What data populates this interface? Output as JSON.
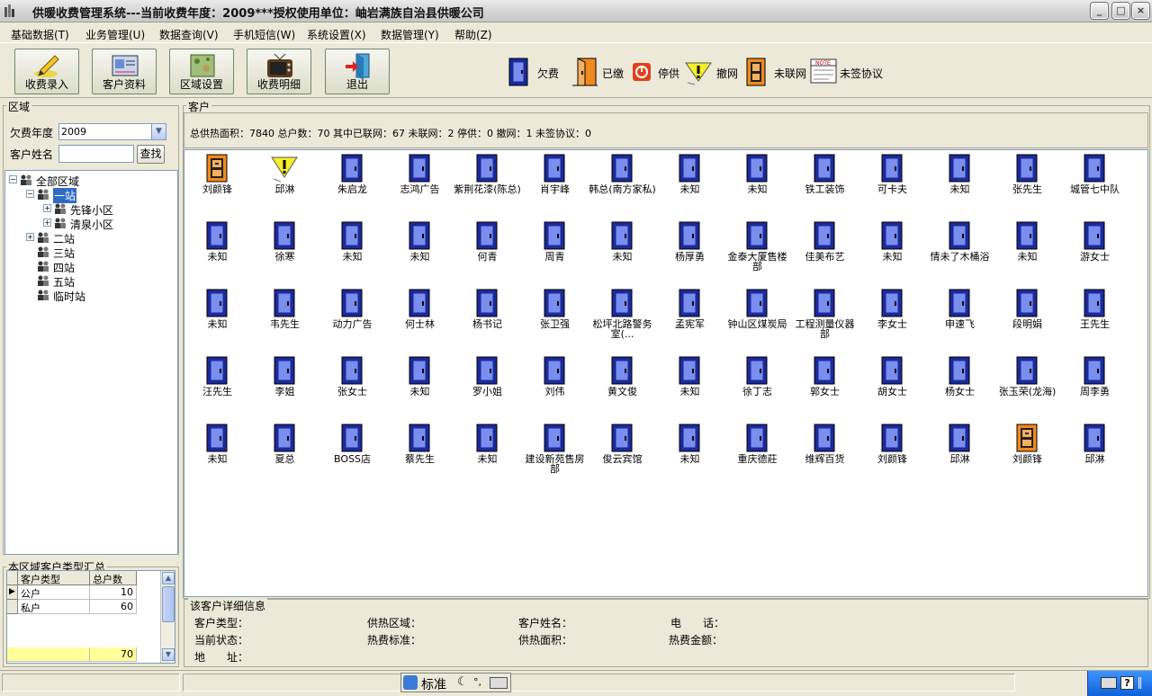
{
  "window": {
    "title": "供暖收费管理系统---当前收费年度：2009***授权使用单位：岫岩满族自治县供暖公司",
    "min_glyph": "_",
    "max_glyph": "□",
    "close_glyph": "×"
  },
  "menu": [
    {
      "label": "基础数据(T)"
    },
    {
      "label": "业务管理(U)"
    },
    {
      "label": "数据查询(V)"
    },
    {
      "label": "手机短信(W)"
    },
    {
      "label": "系统设置(X)"
    },
    {
      "label": "数据管理(Y)"
    },
    {
      "label": "帮助(Z)"
    }
  ],
  "toolbar": [
    {
      "label": "收费录入",
      "icon": "pencil-icon"
    },
    {
      "label": "客户资料",
      "icon": "card-icon"
    },
    {
      "label": "区域设置",
      "icon": "map-icon"
    },
    {
      "label": "收费明细",
      "icon": "tv-icon"
    },
    {
      "label": "退出",
      "icon": "exit-door-icon"
    }
  ],
  "legend": [
    {
      "label": "欠费",
      "icon": "door-blue"
    },
    {
      "label": "已缴",
      "icon": "door-orange-open"
    },
    {
      "label": "停供",
      "icon": "stop-icon"
    },
    {
      "label": "撤网",
      "icon": "warning-icon"
    },
    {
      "label": "未联网",
      "icon": "door-safe"
    },
    {
      "label": "未签协议",
      "icon": "note-icon"
    }
  ],
  "area_panel": {
    "title": "区域",
    "year_label": "欠费年度",
    "year_value": "2009",
    "name_label": "客户姓名",
    "name_value": "",
    "search_label": "查找"
  },
  "tree": [
    {
      "label": "全部区域",
      "level": 0,
      "expander": "−",
      "selected": false
    },
    {
      "label": "一站",
      "level": 1,
      "expander": "−",
      "selected": true
    },
    {
      "label": "先锋小区",
      "level": 2,
      "expander": "+",
      "selected": false
    },
    {
      "label": "清泉小区",
      "level": 2,
      "expander": "+",
      "selected": false
    },
    {
      "label": "二站",
      "level": 1,
      "expander": "+",
      "selected": false
    },
    {
      "label": "三站",
      "level": 1,
      "expander": "",
      "selected": false
    },
    {
      "label": "四站",
      "level": 1,
      "expander": "",
      "selected": false
    },
    {
      "label": "五站",
      "level": 1,
      "expander": "",
      "selected": false
    },
    {
      "label": "临时站",
      "level": 1,
      "expander": "",
      "selected": false
    }
  ],
  "summary": {
    "title": "本区域客户类型汇总",
    "headers": [
      "客户类型",
      "总户数"
    ],
    "rows": [
      {
        "type": "公户",
        "count": "10"
      },
      {
        "type": "私户",
        "count": "60"
      }
    ],
    "total": "70"
  },
  "customers_panel": {
    "title": "客户",
    "stats": "总供热面积：7840 总户数：70 其中已联网：67 未联网：2 停供：0 撤网：1 未签协议：0"
  },
  "customers": [
    {
      "name": "刘颜锋",
      "status": "safe"
    },
    {
      "name": "邱淋",
      "status": "warning"
    },
    {
      "name": "朱启龙",
      "status": "blue"
    },
    {
      "name": "志鸿广告",
      "status": "blue"
    },
    {
      "name": "紫荆花漆(陈总)",
      "status": "blue"
    },
    {
      "name": "肖宇峰",
      "status": "blue"
    },
    {
      "name": "韩总(南方家私)",
      "status": "blue"
    },
    {
      "name": "未知",
      "status": "blue"
    },
    {
      "name": "未知",
      "status": "blue"
    },
    {
      "name": "铁工装饰",
      "status": "blue"
    },
    {
      "name": "可卡夫",
      "status": "blue"
    },
    {
      "name": "未知",
      "status": "blue"
    },
    {
      "name": "张先生",
      "status": "blue"
    },
    {
      "name": "城管七中队",
      "status": "blue"
    },
    {
      "name": "未知",
      "status": "blue"
    },
    {
      "name": "徐寒",
      "status": "blue"
    },
    {
      "name": "未知",
      "status": "blue"
    },
    {
      "name": "未知",
      "status": "blue"
    },
    {
      "name": "何青",
      "status": "blue"
    },
    {
      "name": "周青",
      "status": "blue"
    },
    {
      "name": "未知",
      "status": "blue"
    },
    {
      "name": "杨厚勇",
      "status": "blue"
    },
    {
      "name": "金泰大厦售楼部",
      "status": "blue"
    },
    {
      "name": "佳美布艺",
      "status": "blue"
    },
    {
      "name": "未知",
      "status": "blue"
    },
    {
      "name": "情未了木桶浴",
      "status": "blue"
    },
    {
      "name": "未知",
      "status": "blue"
    },
    {
      "name": "游女士",
      "status": "blue"
    },
    {
      "name": "未知",
      "status": "blue"
    },
    {
      "name": "韦先生",
      "status": "blue"
    },
    {
      "name": "动力广告",
      "status": "blue"
    },
    {
      "name": "何士林",
      "status": "blue"
    },
    {
      "name": "杨书记",
      "status": "blue"
    },
    {
      "name": "张卫强",
      "status": "blue"
    },
    {
      "name": "松坪北路警务室(...",
      "status": "blue"
    },
    {
      "name": "孟宪军",
      "status": "blue"
    },
    {
      "name": "钟山区煤炭局",
      "status": "blue"
    },
    {
      "name": "工程测量仪器部",
      "status": "blue"
    },
    {
      "name": "李女士",
      "status": "blue"
    },
    {
      "name": "申速飞",
      "status": "blue"
    },
    {
      "name": "段明娟",
      "status": "blue"
    },
    {
      "name": "王先生",
      "status": "blue"
    },
    {
      "name": "汪先生",
      "status": "blue"
    },
    {
      "name": "李姐",
      "status": "blue"
    },
    {
      "name": "张女士",
      "status": "blue"
    },
    {
      "name": "未知",
      "status": "blue"
    },
    {
      "name": "罗小姐",
      "status": "blue"
    },
    {
      "name": "刘伟",
      "status": "blue"
    },
    {
      "name": "黄文俊",
      "status": "blue"
    },
    {
      "name": "未知",
      "status": "blue"
    },
    {
      "name": "徐丁志",
      "status": "blue"
    },
    {
      "name": "郭女士",
      "status": "blue"
    },
    {
      "name": "胡女士",
      "status": "blue"
    },
    {
      "name": "杨女士",
      "status": "blue"
    },
    {
      "name": "张玉荣(龙海)",
      "status": "blue"
    },
    {
      "name": "周李勇",
      "status": "blue"
    },
    {
      "name": "未知",
      "status": "blue"
    },
    {
      "name": "夏总",
      "status": "blue"
    },
    {
      "name": "BOSS店",
      "status": "blue"
    },
    {
      "name": "蔡先生",
      "status": "blue"
    },
    {
      "name": "未知",
      "status": "blue"
    },
    {
      "name": "建设新苑售房部",
      "status": "blue"
    },
    {
      "name": "俊云宾馆",
      "status": "blue"
    },
    {
      "name": "未知",
      "status": "blue"
    },
    {
      "name": "重庆德莊",
      "status": "blue"
    },
    {
      "name": "维辉百货",
      "status": "blue"
    },
    {
      "name": "刘颜锋",
      "status": "blue"
    },
    {
      "name": "邱淋",
      "status": "blue"
    },
    {
      "name": "刘颜锋",
      "status": "safe"
    },
    {
      "name": "邱淋",
      "status": "blue"
    }
  ],
  "detail": {
    "title": "该客户详细信息",
    "fields": [
      {
        "label": "客户类型："
      },
      {
        "label": "供热区域："
      },
      {
        "label": "客户姓名："
      },
      {
        "label": "电　　话："
      },
      {
        "label": "当前状态："
      },
      {
        "label": "热费标准："
      },
      {
        "label": "供热面积："
      },
      {
        "label": "热费金额："
      },
      {
        "label": "地　　址："
      }
    ]
  },
  "statusbar": {
    "ime_mode": "标准",
    "tray_help": "?"
  },
  "colors": {
    "door_blue": "#2a3fc8",
    "door_orange": "#f08a1e",
    "selection": "#316ac5",
    "total_row": "#ffff99"
  }
}
